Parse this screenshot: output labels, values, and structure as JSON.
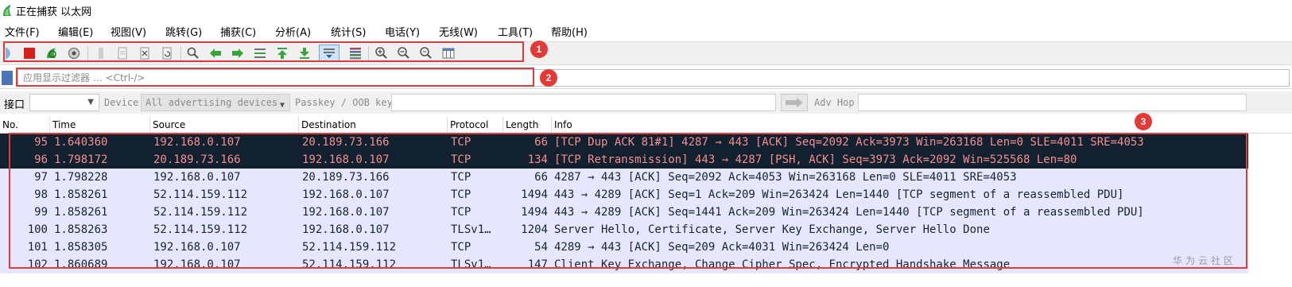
{
  "window": {
    "title": "正在捕获 以太网",
    "app_icon": "wireshark-fin-icon"
  },
  "menu": [
    "文件(F)",
    "编辑(E)",
    "视图(V)",
    "跳转(G)",
    "捕获(C)",
    "分析(A)",
    "统计(S)",
    "电话(Y)",
    "无线(W)",
    "工具(T)",
    "帮助(H)"
  ],
  "toolbar": {
    "buttons": [
      "start-capture-icon",
      "stop-capture-icon",
      "restart-capture-icon",
      "capture-options-icon",
      "open-file-icon",
      "save-file-icon",
      "close-file-icon",
      "reload-file-icon",
      "find-packet-icon",
      "go-back-icon",
      "go-forward-icon",
      "go-to-packet-icon",
      "go-first-icon",
      "go-last-icon",
      "autoscroll-icon",
      "colorize-icon",
      "zoom-in-icon",
      "zoom-out-icon",
      "zoom-normal-icon",
      "resize-columns-icon"
    ],
    "pressed": "autoscroll-icon"
  },
  "callouts": [
    "1",
    "2",
    "3"
  ],
  "accent": {
    "callout": "#e53935",
    "bad_row_bg": "#11212f",
    "bad_row_fg": "#f78d8d",
    "normal_row_bg": "#e7e6ff"
  },
  "filter": {
    "placeholder": "应用显示过滤器 … <Ctrl-/>"
  },
  "interface_bar": {
    "iface_label": "接口",
    "iface_value": "",
    "device_label": "Device",
    "device_value": "All advertising devices",
    "passkey_label": "Passkey / OOB key",
    "adv_hop_label": "Adv Hop"
  },
  "packet_list": {
    "columns": [
      "No.",
      "Time",
      "Source",
      "Destination",
      "Protocol",
      "Length",
      "Info"
    ],
    "rows": [
      {
        "no": "95",
        "time": "1.640360",
        "src": "192.168.0.107",
        "dst": "20.189.73.166",
        "proto": "TCP",
        "len": "66",
        "info": "[TCP Dup ACK 81#1] 4287 → 443 [ACK] Seq=2092 Ack=3973 Win=263168 Len=0 SLE=4011 SRE=4053",
        "style": "bad"
      },
      {
        "no": "96",
        "time": "1.798172",
        "src": "20.189.73.166",
        "dst": "192.168.0.107",
        "proto": "TCP",
        "len": "134",
        "info": "[TCP Retransmission] 443 → 4287 [PSH, ACK] Seq=3973 Ack=2092 Win=525568 Len=80",
        "style": "bad"
      },
      {
        "no": "97",
        "time": "1.798228",
        "src": "192.168.0.107",
        "dst": "20.189.73.166",
        "proto": "TCP",
        "len": "66",
        "info": "4287 → 443 [ACK] Seq=2092 Ack=4053 Win=263168 Len=0 SLE=4011 SRE=4053",
        "style": "normal"
      },
      {
        "no": "98",
        "time": "1.858261",
        "src": "52.114.159.112",
        "dst": "192.168.0.107",
        "proto": "TCP",
        "len": "1494",
        "info": "443 → 4289 [ACK] Seq=1 Ack=209 Win=263424 Len=1440 [TCP segment of a reassembled PDU]",
        "style": "normal"
      },
      {
        "no": "99",
        "time": "1.858261",
        "src": "52.114.159.112",
        "dst": "192.168.0.107",
        "proto": "TCP",
        "len": "1494",
        "info": "443 → 4289 [ACK] Seq=1441 Ack=209 Win=263424 Len=1440 [TCP segment of a reassembled PDU]",
        "style": "normal"
      },
      {
        "no": "100",
        "time": "1.858263",
        "src": "52.114.159.112",
        "dst": "192.168.0.107",
        "proto": "TLSv1…",
        "len": "1204",
        "info": "Server Hello, Certificate, Server Key Exchange, Server Hello Done",
        "style": "normal"
      },
      {
        "no": "101",
        "time": "1.858305",
        "src": "192.168.0.107",
        "dst": "52.114.159.112",
        "proto": "TCP",
        "len": "54",
        "info": "4289 → 443 [ACK] Seq=209 Ack=4031 Win=263424 Len=0",
        "style": "normal"
      },
      {
        "no": "102",
        "time": "1.860689",
        "src": "192.168.0.107",
        "dst": "52.114.159.112",
        "proto": "TLSv1…",
        "len": "147",
        "info": "Client Key Exchange, Change Cipher Spec, Encrypted Handshake Message",
        "style": "normal"
      }
    ]
  },
  "watermark": "华为云社区"
}
